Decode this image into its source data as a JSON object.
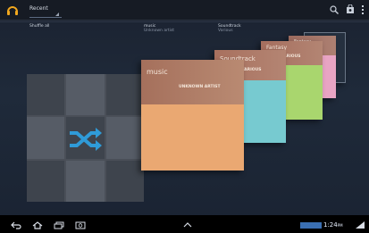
{
  "action_bar": {
    "title": "Recent",
    "icons": [
      "headphones-icon",
      "search-icon",
      "shop-icon",
      "overflow-menu-icon"
    ]
  },
  "sections": {
    "shuffle": {
      "label": "Shuffle all"
    },
    "music": {
      "label": "music",
      "sublabel": "Unknown artist"
    },
    "soundtrack": {
      "label": "Soundtrack",
      "sublabel": "Various"
    }
  },
  "cards": {
    "music": {
      "title": "music",
      "artist": "UNKNOWN ARTIST"
    },
    "soundtrack": {
      "title": "Soundtrack",
      "artist": "VARIOUS"
    },
    "third": {
      "title": "Fantasy",
      "artist": "VARIOUS"
    },
    "fourth": {
      "title": "Fantasy",
      "artist": "VARIOUS"
    }
  },
  "system_bar": {
    "time": "1:24",
    "meridiem": "PM",
    "icons": [
      "back-icon",
      "home-icon",
      "recent-apps-icon",
      "screenshot-icon",
      "up-caret-icon",
      "status-icon",
      "signal-icon"
    ]
  },
  "colors": {
    "music_body": "#eaa872",
    "soundtrack_body": "#77cad0",
    "third_body": "#a9d66e",
    "fourth_body": "#e8a4c3",
    "shuffle_accent": "#2f9bd8"
  }
}
